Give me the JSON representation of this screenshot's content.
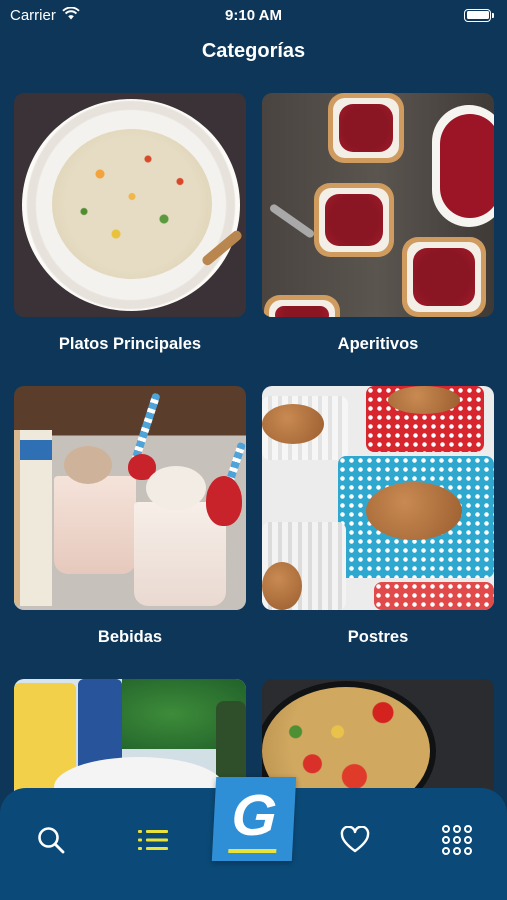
{
  "status_bar": {
    "carrier": "Carrier",
    "time": "9:10 AM"
  },
  "header": {
    "title": "Categorías"
  },
  "categories": [
    {
      "label": "Platos Principales"
    },
    {
      "label": "Aperitivos"
    },
    {
      "label": "Bebidas"
    },
    {
      "label": "Postres"
    },
    {
      "label": ""
    },
    {
      "label": ""
    }
  ],
  "tabbar": {
    "items": [
      "search-icon",
      "list-icon",
      "goya-logo",
      "heart-icon",
      "grid-icon"
    ],
    "active": "list-icon",
    "accent_color": "#e8e23a",
    "logo_letter": "G"
  },
  "colors": {
    "background": "#0d3658",
    "tabbar": "#0b4a78",
    "logo": "#2f8fd6"
  }
}
